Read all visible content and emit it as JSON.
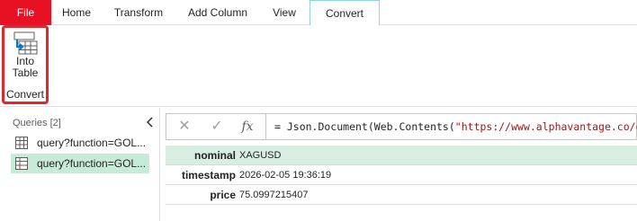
{
  "tabs": {
    "file": "File",
    "home": "Home",
    "transform": "Transform",
    "add_column": "Add Column",
    "view": "View",
    "convert": "Convert"
  },
  "ribbon": {
    "into_table_line1": "Into",
    "into_table_line2": "Table",
    "group_label": "Convert",
    "accent_color": "#e0262f"
  },
  "queries": {
    "header": "Queries [2]",
    "items": [
      {
        "label": "query?function=GOL...",
        "icon": "table-icon"
      },
      {
        "label": "query?function=GOL...",
        "icon": "record-table-icon",
        "selected": true
      }
    ]
  },
  "formula_bar": {
    "prefix": "= Json.Document(Web.Contents(",
    "string_part": "\"https://www.alphavantage.co/que"
  },
  "record": {
    "rows": [
      {
        "key": "nominal",
        "value": "XAGUSD"
      },
      {
        "key": "timestamp",
        "value": "2026-02-05 19:36:19"
      },
      {
        "key": "price",
        "value": "75.0997215407"
      }
    ]
  }
}
